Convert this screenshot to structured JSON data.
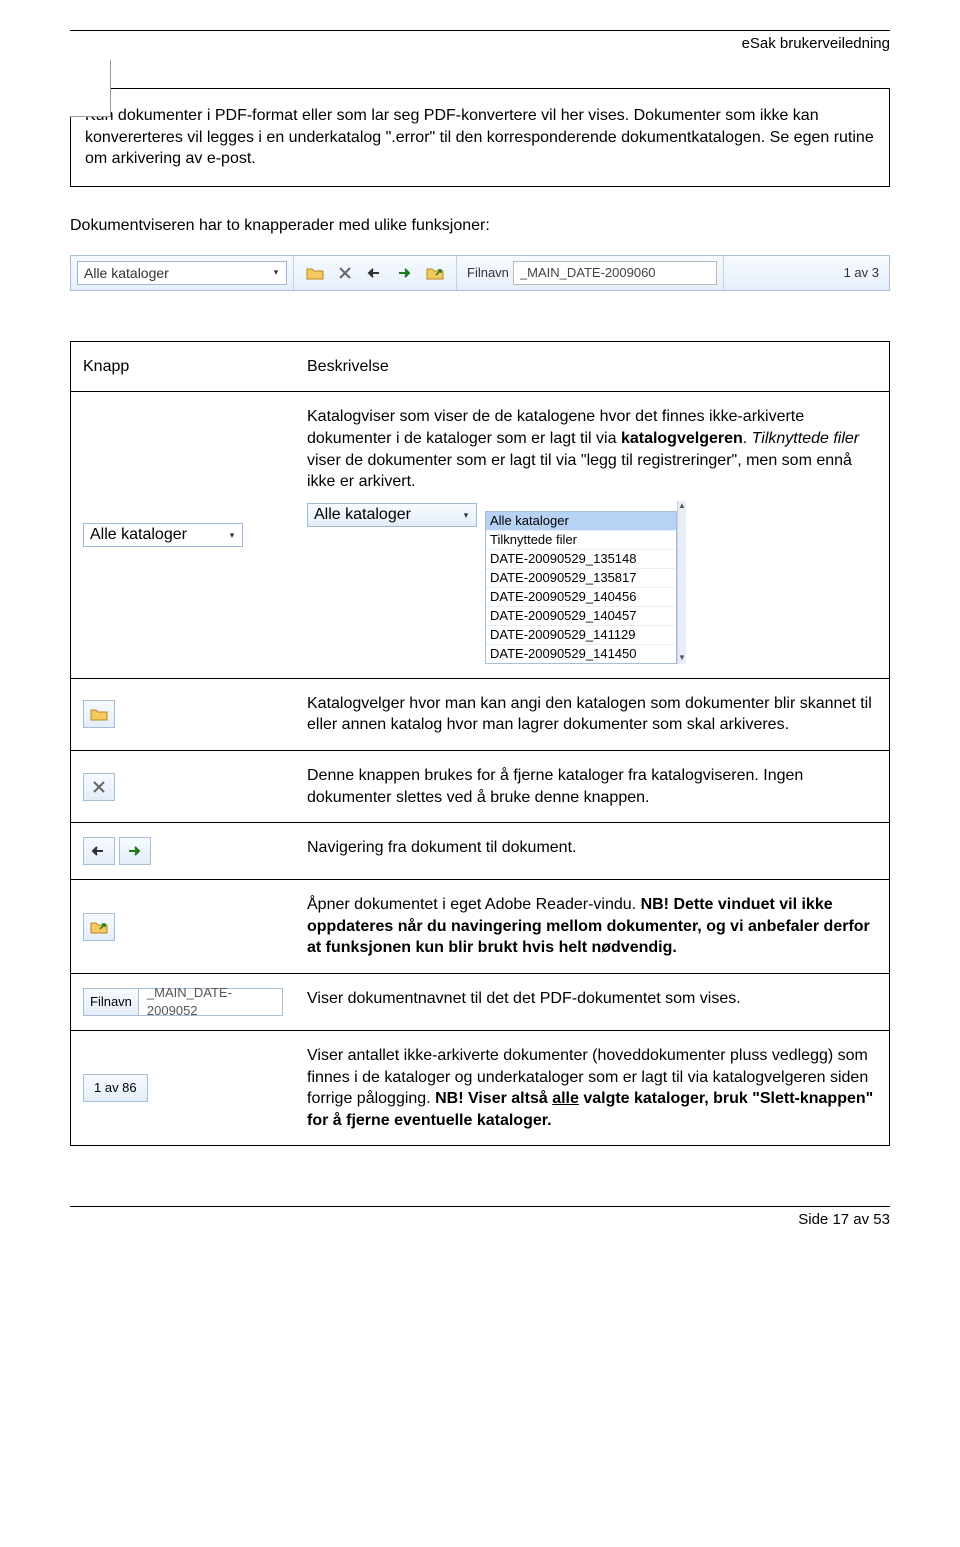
{
  "header": {
    "title": "eSak brukerveiledning"
  },
  "infobox": "Kun dokumenter i PDF-format eller som lar seg PDF-konvertere vil her vises. Dokumenter som ikke kan konvererteres vil legges i en underkatalog \".error\" til den korresponderende dokumentkatalogen. Se egen rutine om arkivering av e-post.",
  "intro": "Dokumentviseren har to knapperader med ulike funksjoner:",
  "toolbar": {
    "catalog_label": "Alle kataloger",
    "filnavn_label": "Filnavn",
    "filnavn_value": "_MAIN_DATE-2009060",
    "count": "1 av 3"
  },
  "table": {
    "h1": "Knapp",
    "h2": "Beskrivelse",
    "r1": {
      "text_a": "Katalogviser som viser de de katalogene hvor det finnes ikke-arkiverte dokumenter i de kataloger som er lagt til via ",
      "bold1": "katalogvelgeren",
      "text_b": ". ",
      "italic1": "Tilknyttede filer",
      "text_c": " viser de dokumenter som er lagt til via \"legg til registreringer\", men som ennå ikke er arkivert.",
      "drop_label": "Alle kataloger",
      "list": [
        "Alle kataloger",
        "Tilknyttede filer",
        "DATE-20090529_135148",
        "DATE-20090529_135817",
        "DATE-20090529_140456",
        "DATE-20090529_140457",
        "DATE-20090529_141129",
        "DATE-20090529_141450"
      ]
    },
    "r2": "Katalogvelger hvor man kan angi den katalogen som dokumenter blir skannet til eller annen katalog hvor man lagrer dokumenter som skal arkiveres.",
    "r3": "Denne knappen brukes for å fjerne kataloger fra katalogviseren. Ingen dokumenter slettes ved å bruke denne knappen.",
    "r4": "Navigering fra dokument til dokument.",
    "r5_a": "Åpner dokumentet i eget Adobe Reader-vindu. ",
    "r5_b": "NB! Dette vinduet vil ikke oppdateres når du navingering mellom dokumenter, og vi anbefaler derfor at funksjonen kun blir brukt hvis helt nødvendig.",
    "r6_label": "Filnavn",
    "r6_value": "_MAIN_DATE-2009052",
    "r6": "Viser dokumentnavnet til det det PDF-dokumentet som vises.",
    "r7_count": "1 av 86",
    "r7_a": "Viser antallet ikke-arkiverte dokumenter (hoveddokumenter pluss vedlegg) som finnes i de kataloger og underkataloger som er lagt til via katalogvelgeren siden forrige pålogging. ",
    "r7_b": "NB! Viser altså ",
    "r7_u": "alle",
    "r7_c": " valgte kataloger, bruk \"Slett-knappen\" for å fjerne eventuelle kataloger."
  },
  "footer": {
    "text": "Side 17 av 53"
  }
}
